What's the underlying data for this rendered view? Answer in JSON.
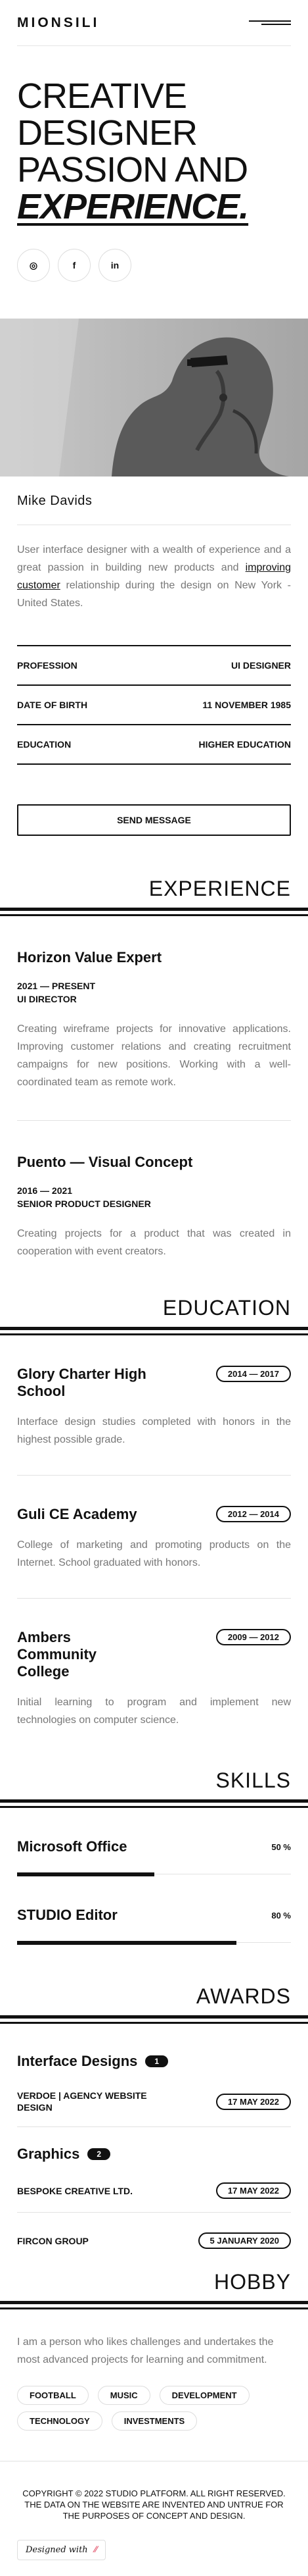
{
  "header": {
    "logo": "MIONSILI"
  },
  "hero": {
    "title_line1": "CREATIVE",
    "title_line2": "DESIGNER",
    "title_line3": "PASSION AND",
    "title_em": "EXPERIENCE.",
    "socials": [
      {
        "icon": "instagram-icon",
        "glyph": "◎"
      },
      {
        "icon": "facebook-icon",
        "glyph": "f"
      },
      {
        "icon": "linkedin-icon",
        "glyph": "in"
      }
    ]
  },
  "profile": {
    "name": "Mike Davids",
    "bio_before": "User interface designer with a wealth of experience and a great passion in building new products and ",
    "bio_link": "improving customer",
    "bio_after": " relationship during the design on New York - United States.",
    "info": [
      {
        "label": "PROFESSION",
        "value": "UI DESIGNER"
      },
      {
        "label": "DATE OF BIRTH",
        "value": "11 NOVEMBER 1985"
      },
      {
        "label": "EDUCATION",
        "value": "HIGHER EDUCATION"
      }
    ],
    "send_label": "SEND MESSAGE"
  },
  "experience": {
    "title": "EXPERIENCE",
    "items": [
      {
        "title": "Horizon Value Expert",
        "years": "2021 — PRESENT",
        "role": "UI DIRECTOR",
        "desc": "Creating wireframe projects for innovative applications. Improving customer relations and creating recruitment campaigns for new positions. Working with a well-coordinated team as remote work."
      },
      {
        "title": "Puento — Visual Concept",
        "years": "2016 — 2021",
        "role": "SENIOR PRODUCT DESIGNER",
        "desc": "Creating projects for a product that was created in cooperation with event creators."
      }
    ]
  },
  "education": {
    "title": "EDUCATION",
    "items": [
      {
        "title": "Glory Charter High School",
        "years": "2014 — 2017",
        "desc": "Interface design studies completed with honors in the highest possible grade."
      },
      {
        "title": "Guli CE Academy",
        "years": "2012 — 2014",
        "desc": "College of marketing and promoting products on the Internet. School graduated with honors."
      },
      {
        "title": "Ambers Community College",
        "years": "2009 — 2012",
        "desc": "Initial learning to program and implement new technologies on computer science."
      }
    ]
  },
  "skills": {
    "title": "SKILLS",
    "items": [
      {
        "name": "Microsoft Office",
        "label": "50 %",
        "level": 0.5
      },
      {
        "name": "STUDIO Editor",
        "label": "80 %",
        "level": 0.8
      }
    ]
  },
  "awards": {
    "title": "AWARDS",
    "groups": [
      {
        "name": "Interface Designs",
        "count": "1",
        "rows": [
          {
            "name": "VERDOE | AGENCY WEBSITE DESIGN",
            "date": "17 MAY 2022"
          }
        ]
      },
      {
        "name": "Graphics",
        "count": "2",
        "rows": [
          {
            "name": "BESPOKE CREATIVE LTD.",
            "date": "17 MAY 2022"
          },
          {
            "name": "FIRCON GROUP",
            "date": "5 JANUARY 2020"
          }
        ]
      }
    ]
  },
  "hobby": {
    "title": "HOBBY",
    "text": "I am a person who likes challenges and undertakes the most advanced projects for learning and commitment.",
    "tags": [
      "FOOTBALL",
      "MUSIC",
      "DEVELOPMENT",
      "TECHNOLOGY",
      "INVESTMENTS"
    ]
  },
  "footer": {
    "copyright": "COPYRIGHT © 2022 STUDIO PLATFORM. ALL RIGHT RESERVED.",
    "disclaimer": "THE DATA ON THE WEBSITE ARE INVENTED AND UNTRUE FOR THE PURPOSES OF CONCEPT AND DESIGN.",
    "designed_with": "Designed with"
  },
  "colors": {
    "text": "#111111",
    "muted": "#777777",
    "rule": "#e2e2e2",
    "accent": "#e0455f"
  }
}
